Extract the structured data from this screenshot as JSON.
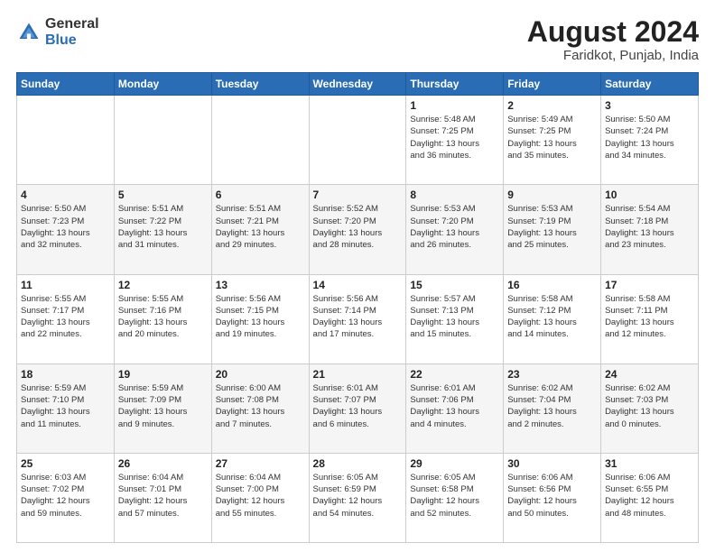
{
  "logo": {
    "general": "General",
    "blue": "Blue"
  },
  "title": {
    "month_year": "August 2024",
    "location": "Faridkot, Punjab, India"
  },
  "weekdays": [
    "Sunday",
    "Monday",
    "Tuesday",
    "Wednesday",
    "Thursday",
    "Friday",
    "Saturday"
  ],
  "weeks": [
    [
      {
        "day": "",
        "info": ""
      },
      {
        "day": "",
        "info": ""
      },
      {
        "day": "",
        "info": ""
      },
      {
        "day": "",
        "info": ""
      },
      {
        "day": "1",
        "info": "Sunrise: 5:48 AM\nSunset: 7:25 PM\nDaylight: 13 hours\nand 36 minutes."
      },
      {
        "day": "2",
        "info": "Sunrise: 5:49 AM\nSunset: 7:25 PM\nDaylight: 13 hours\nand 35 minutes."
      },
      {
        "day": "3",
        "info": "Sunrise: 5:50 AM\nSunset: 7:24 PM\nDaylight: 13 hours\nand 34 minutes."
      }
    ],
    [
      {
        "day": "4",
        "info": "Sunrise: 5:50 AM\nSunset: 7:23 PM\nDaylight: 13 hours\nand 32 minutes."
      },
      {
        "day": "5",
        "info": "Sunrise: 5:51 AM\nSunset: 7:22 PM\nDaylight: 13 hours\nand 31 minutes."
      },
      {
        "day": "6",
        "info": "Sunrise: 5:51 AM\nSunset: 7:21 PM\nDaylight: 13 hours\nand 29 minutes."
      },
      {
        "day": "7",
        "info": "Sunrise: 5:52 AM\nSunset: 7:20 PM\nDaylight: 13 hours\nand 28 minutes."
      },
      {
        "day": "8",
        "info": "Sunrise: 5:53 AM\nSunset: 7:20 PM\nDaylight: 13 hours\nand 26 minutes."
      },
      {
        "day": "9",
        "info": "Sunrise: 5:53 AM\nSunset: 7:19 PM\nDaylight: 13 hours\nand 25 minutes."
      },
      {
        "day": "10",
        "info": "Sunrise: 5:54 AM\nSunset: 7:18 PM\nDaylight: 13 hours\nand 23 minutes."
      }
    ],
    [
      {
        "day": "11",
        "info": "Sunrise: 5:55 AM\nSunset: 7:17 PM\nDaylight: 13 hours\nand 22 minutes."
      },
      {
        "day": "12",
        "info": "Sunrise: 5:55 AM\nSunset: 7:16 PM\nDaylight: 13 hours\nand 20 minutes."
      },
      {
        "day": "13",
        "info": "Sunrise: 5:56 AM\nSunset: 7:15 PM\nDaylight: 13 hours\nand 19 minutes."
      },
      {
        "day": "14",
        "info": "Sunrise: 5:56 AM\nSunset: 7:14 PM\nDaylight: 13 hours\nand 17 minutes."
      },
      {
        "day": "15",
        "info": "Sunrise: 5:57 AM\nSunset: 7:13 PM\nDaylight: 13 hours\nand 15 minutes."
      },
      {
        "day": "16",
        "info": "Sunrise: 5:58 AM\nSunset: 7:12 PM\nDaylight: 13 hours\nand 14 minutes."
      },
      {
        "day": "17",
        "info": "Sunrise: 5:58 AM\nSunset: 7:11 PM\nDaylight: 13 hours\nand 12 minutes."
      }
    ],
    [
      {
        "day": "18",
        "info": "Sunrise: 5:59 AM\nSunset: 7:10 PM\nDaylight: 13 hours\nand 11 minutes."
      },
      {
        "day": "19",
        "info": "Sunrise: 5:59 AM\nSunset: 7:09 PM\nDaylight: 13 hours\nand 9 minutes."
      },
      {
        "day": "20",
        "info": "Sunrise: 6:00 AM\nSunset: 7:08 PM\nDaylight: 13 hours\nand 7 minutes."
      },
      {
        "day": "21",
        "info": "Sunrise: 6:01 AM\nSunset: 7:07 PM\nDaylight: 13 hours\nand 6 minutes."
      },
      {
        "day": "22",
        "info": "Sunrise: 6:01 AM\nSunset: 7:06 PM\nDaylight: 13 hours\nand 4 minutes."
      },
      {
        "day": "23",
        "info": "Sunrise: 6:02 AM\nSunset: 7:04 PM\nDaylight: 13 hours\nand 2 minutes."
      },
      {
        "day": "24",
        "info": "Sunrise: 6:02 AM\nSunset: 7:03 PM\nDaylight: 13 hours\nand 0 minutes."
      }
    ],
    [
      {
        "day": "25",
        "info": "Sunrise: 6:03 AM\nSunset: 7:02 PM\nDaylight: 12 hours\nand 59 minutes."
      },
      {
        "day": "26",
        "info": "Sunrise: 6:04 AM\nSunset: 7:01 PM\nDaylight: 12 hours\nand 57 minutes."
      },
      {
        "day": "27",
        "info": "Sunrise: 6:04 AM\nSunset: 7:00 PM\nDaylight: 12 hours\nand 55 minutes."
      },
      {
        "day": "28",
        "info": "Sunrise: 6:05 AM\nSunset: 6:59 PM\nDaylight: 12 hours\nand 54 minutes."
      },
      {
        "day": "29",
        "info": "Sunrise: 6:05 AM\nSunset: 6:58 PM\nDaylight: 12 hours\nand 52 minutes."
      },
      {
        "day": "30",
        "info": "Sunrise: 6:06 AM\nSunset: 6:56 PM\nDaylight: 12 hours\nand 50 minutes."
      },
      {
        "day": "31",
        "info": "Sunrise: 6:06 AM\nSunset: 6:55 PM\nDaylight: 12 hours\nand 48 minutes."
      }
    ]
  ]
}
